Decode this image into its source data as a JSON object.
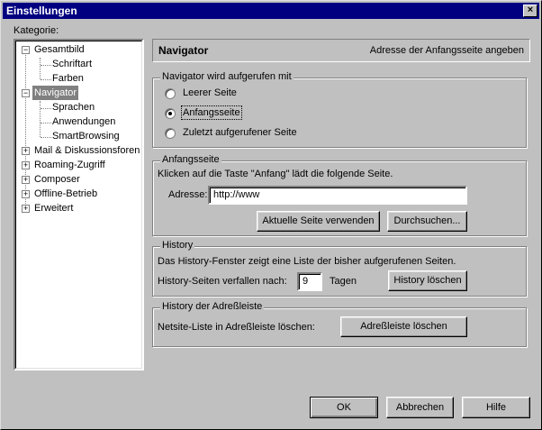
{
  "window": {
    "title": "Einstellungen"
  },
  "kategorie_label": "Kategorie:",
  "tree": [
    {
      "label": "Gesamtbild"
    },
    {
      "label": "Schriftart"
    },
    {
      "label": "Farben"
    },
    {
      "label": "Navigator"
    },
    {
      "label": "Sprachen"
    },
    {
      "label": "Anwendungen"
    },
    {
      "label": "SmartBrowsing"
    },
    {
      "label": "Mail & Diskussionsforen"
    },
    {
      "label": "Roaming-Zugriff"
    },
    {
      "label": "Composer"
    },
    {
      "label": "Offline-Betrieb"
    },
    {
      "label": "Erweitert"
    }
  ],
  "tree_icons": {
    "minus": "−",
    "plus": "+"
  },
  "panel": {
    "title": "Navigator",
    "description": "Adresse der Anfangsseite angeben"
  },
  "startup": {
    "legend": "Navigator wird aufgerufen mit",
    "options": [
      "Leerer Seite",
      "Anfangsseite",
      "Zuletzt aufgerufener Seite"
    ],
    "selected": "Anfangsseite"
  },
  "homepage": {
    "legend": "Anfangsseite",
    "info": "Klicken auf die Taste \"Anfang\" lädt die folgende Seite.",
    "address_label": "Adresse:",
    "address_value": "http://www",
    "use_current_button": "Aktuelle Seite verwenden",
    "browse_button": "Durchsuchen..."
  },
  "history": {
    "legend": "History",
    "info": "Das History-Fenster zeigt eine Liste der bisher aufgerufenen Seiten.",
    "expire_label": "History-Seiten verfallen nach:",
    "expire_value": "9",
    "days_label": "Tagen",
    "clear_button": "History löschen"
  },
  "urlbar_history": {
    "legend": "History der Adreßleiste",
    "info": "Netsite-Liste in Adreßleiste löschen:",
    "clear_button": "Adreßleiste löschen"
  },
  "footer": {
    "ok": "OK",
    "cancel": "Abbrechen",
    "help": "Hilfe"
  },
  "close_icon": "×"
}
